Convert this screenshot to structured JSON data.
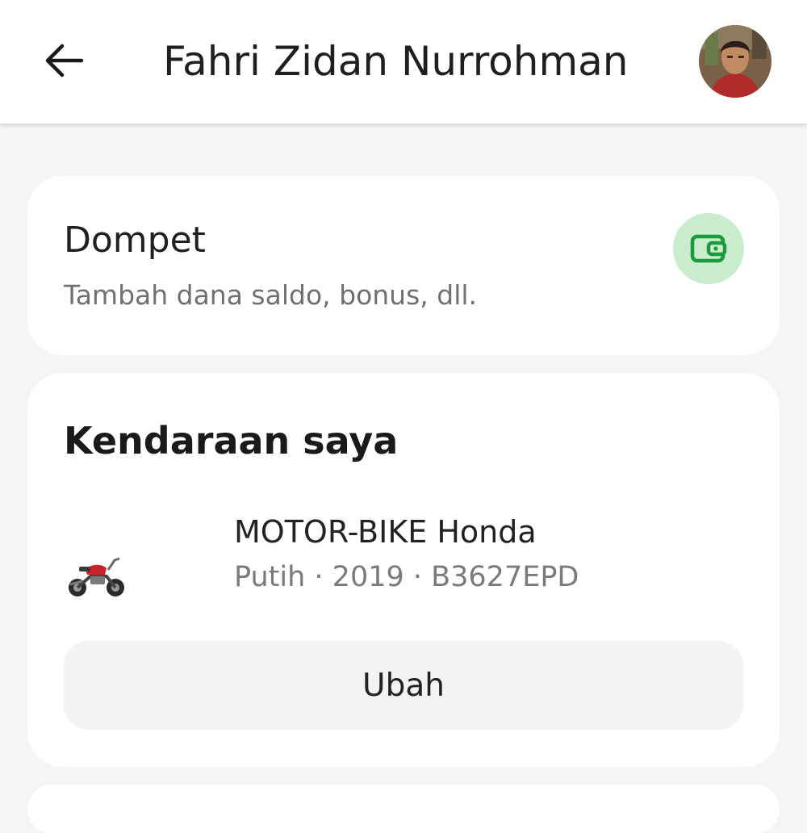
{
  "header": {
    "title": "Fahri Zidan Nurrohman",
    "back_icon": "arrow-left-icon",
    "avatar": "user-avatar-photo"
  },
  "wallet": {
    "title": "Dompet",
    "subtitle": "Tambah dana saldo, bonus, dll.",
    "icon": "wallet-icon",
    "icon_color": "#1e9a3e",
    "icon_bg": "#c9eccd"
  },
  "vehicles": {
    "heading": "Kendaraan saya",
    "items": [
      {
        "icon": "motorbike-icon",
        "name": "MOTOR-BIKE Honda",
        "details": "Putih · 2019 · B3627EPD"
      }
    ],
    "edit_label": "Ubah"
  }
}
